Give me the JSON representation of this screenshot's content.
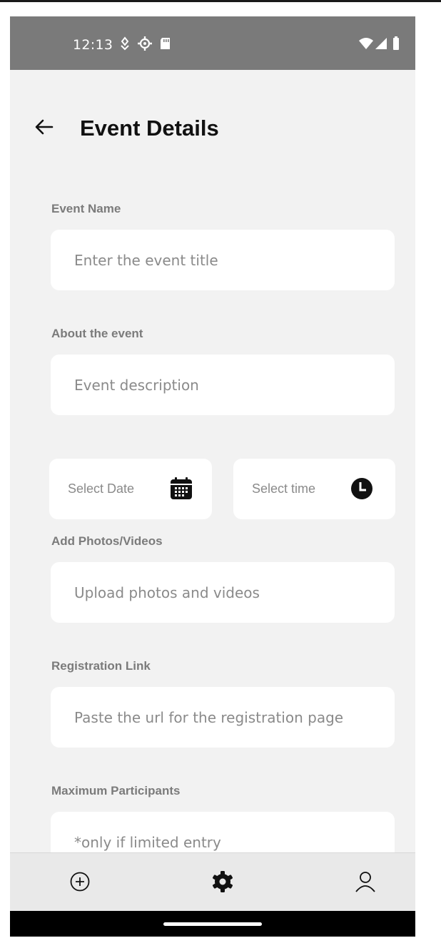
{
  "status_bar": {
    "time": "12:13"
  },
  "header": {
    "title": "Event Details"
  },
  "form": {
    "event_name": {
      "label": "Event Name",
      "placeholder": "Enter the event title"
    },
    "about": {
      "label": "About the event",
      "placeholder": "Event description"
    },
    "date": {
      "placeholder": "Select Date"
    },
    "time": {
      "placeholder": "Select time"
    },
    "media": {
      "label": "Add Photos/Videos",
      "placeholder": "Upload photos and videos"
    },
    "registration": {
      "label": "Registration Link",
      "placeholder": "Paste the url for the registration page"
    },
    "max_participants": {
      "label": "Maximum Participants",
      "placeholder": "*only if limited entry"
    }
  },
  "bottom_nav": {
    "items": [
      "add-circle-icon",
      "gear-icon",
      "person-icon"
    ]
  },
  "colors": {
    "status_bar": "#7a7a7a",
    "background": "#f2f2f2",
    "field": "#ffffff",
    "label": "#7b7b7b",
    "placeholder": "#8a8a8a"
  }
}
